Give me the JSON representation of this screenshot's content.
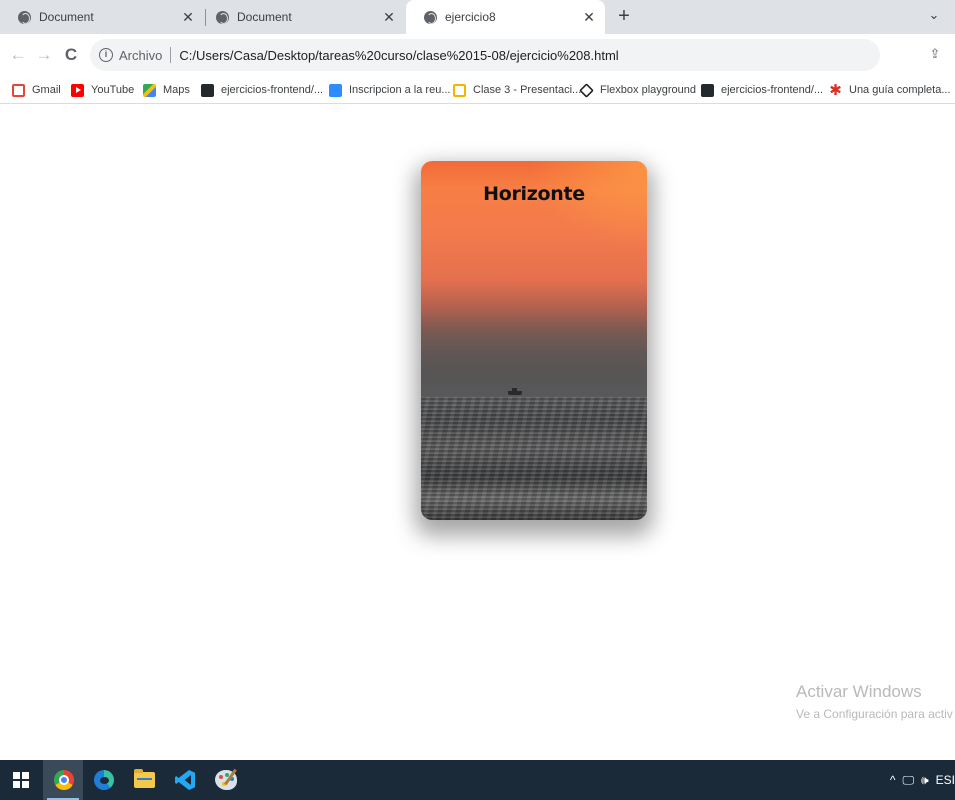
{
  "browser": {
    "tabs": [
      {
        "title": "Document",
        "close": "✕",
        "active": false
      },
      {
        "title": "Document",
        "close": "✕",
        "active": false
      },
      {
        "title": "ejercicio8",
        "close": "✕",
        "active": true
      }
    ],
    "new_tab": "+",
    "tab_search": "⌄",
    "nav": {
      "back": "←",
      "forward": "→",
      "reload": "C"
    },
    "address": {
      "info_icon": "i",
      "scheme_label": "Archivo",
      "url": "C:/Users/Casa/Desktop/tareas%20curso/clase%2015-08/ejercicio%208.html"
    },
    "share_icon": "⇪",
    "bookmarks": [
      {
        "label": "Gmail",
        "icon": "gmail-icon"
      },
      {
        "label": "YouTube",
        "icon": "youtube-icon"
      },
      {
        "label": "Maps",
        "icon": "maps-icon"
      },
      {
        "label": "ejercicios-frontend/...",
        "icon": "github-icon"
      },
      {
        "label": "Inscripcion a la reu...",
        "icon": "zoom-icon"
      },
      {
        "label": "Clase 3 - Presentaci...",
        "icon": "slides-icon"
      },
      {
        "label": "Flexbox playground",
        "icon": "codepen-icon"
      },
      {
        "label": "ejercicios-frontend/...",
        "icon": "github-icon"
      },
      {
        "label": "Una guía completa...",
        "icon": "star-icon"
      }
    ]
  },
  "page": {
    "card_title": "Horizonte"
  },
  "watermark": {
    "line1": "Activar Windows",
    "line2": "Ve a Configuración para activ"
  },
  "taskbar": {
    "apps": [
      "windows-start",
      "chrome",
      "edge",
      "file-explorer",
      "vscode",
      "paint"
    ],
    "tray": {
      "chevron": "^",
      "network": "🖵",
      "volume": "🕪",
      "lang": "ESI"
    }
  }
}
